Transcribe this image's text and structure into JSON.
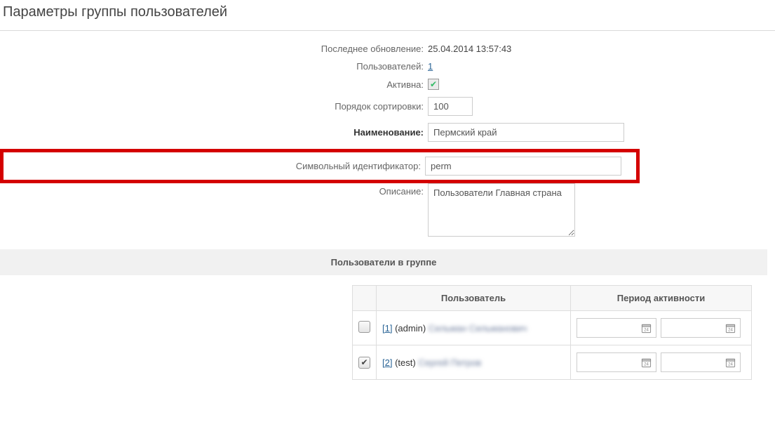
{
  "page": {
    "title": "Параметры группы пользователей"
  },
  "fields": {
    "updated_label": "Последнее обновление:",
    "updated_value": "25.04.2014 13:57:43",
    "users_label": "Пользователей:",
    "users_value": "1",
    "active_label": "Активна:",
    "active_checked": true,
    "sort_label": "Порядок сортировки:",
    "sort_value": "100",
    "name_label": "Наименование:",
    "name_value": "Пермский край",
    "sid_label": "Символьный идентификатор:",
    "sid_value": "perm",
    "desc_label": "Описание:",
    "desc_value": "Пользователи Главная страна"
  },
  "usersSection": {
    "header": "Пользователи в группе",
    "col_user": "Пользователь",
    "col_period": "Период активности"
  },
  "usersTable": [
    {
      "checked": false,
      "id_text": "[1]",
      "login": "(admin)",
      "name_blur": "Сильман Сильманович"
    },
    {
      "checked": true,
      "id_text": "[2]",
      "login": "(test)",
      "name_blur": "Сергей Петров"
    }
  ]
}
